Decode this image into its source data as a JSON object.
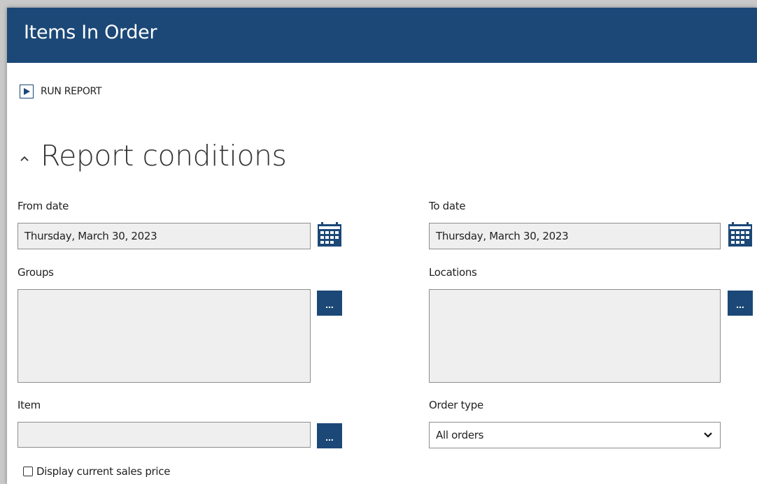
{
  "window": {
    "title": "Items In Order"
  },
  "toolbar": {
    "run_report_label": "RUN REPORT",
    "run_icon": "play-icon"
  },
  "conditions": {
    "title": "Report conditions",
    "collapse_icon": "caret-up-icon",
    "from_date": {
      "label": "From date",
      "value": "Thursday, March 30, 2023",
      "icon": "calendar-icon"
    },
    "to_date": {
      "label": "To date",
      "value": "Thursday, March 30, 2023",
      "icon": "calendar-icon"
    },
    "groups": {
      "label": "Groups",
      "value": "",
      "button_label": "..."
    },
    "locations": {
      "label": "Locations",
      "value": "",
      "button_label": "..."
    },
    "item": {
      "label": "Item",
      "value": "",
      "button_label": "..."
    },
    "order_type": {
      "label": "Order type",
      "selected": "All orders",
      "icon": "chevron-down-icon"
    },
    "display_current_sales_price": {
      "label": "Display current sales price",
      "checked": false
    }
  },
  "colors": {
    "title_bar": "#1b4877",
    "accent": "#1b4877",
    "field_background": "#efefef"
  }
}
